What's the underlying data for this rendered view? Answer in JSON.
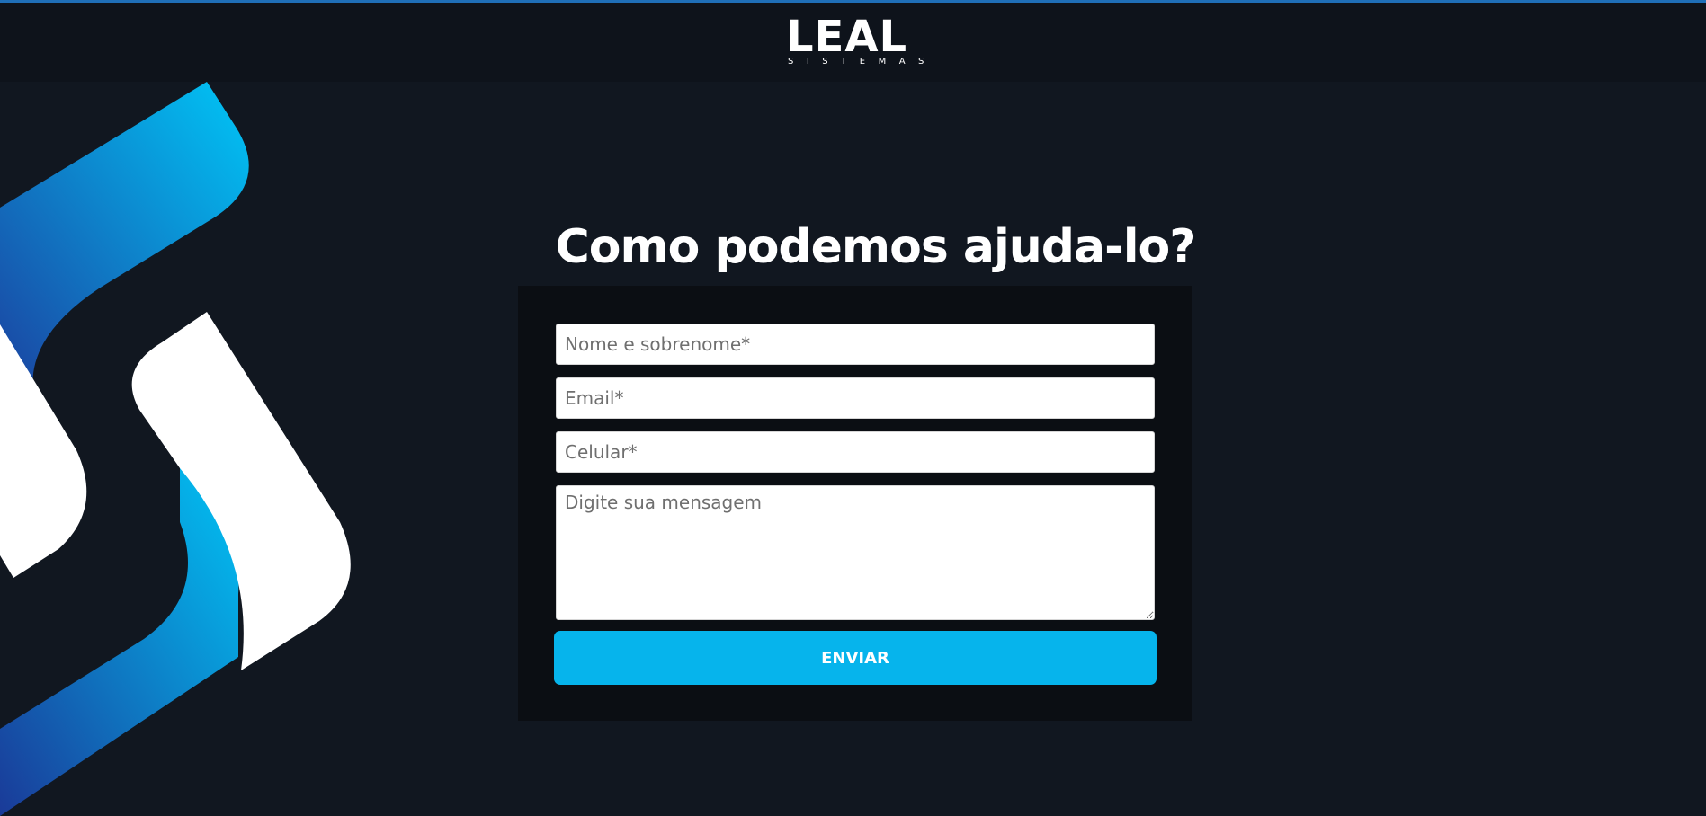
{
  "brand": {
    "name": "LEAL",
    "tagline": "SISTEMAS",
    "accent": "#06b4ec",
    "background": "#111720"
  },
  "main": {
    "title": "Como podemos ajuda-lo?"
  },
  "form": {
    "name_placeholder": "Nome e sobrenome*",
    "email_placeholder": "Email*",
    "phone_placeholder": "Celular*",
    "message_placeholder": "Digite sua mensagem",
    "submit_label": "ENVIAR"
  }
}
